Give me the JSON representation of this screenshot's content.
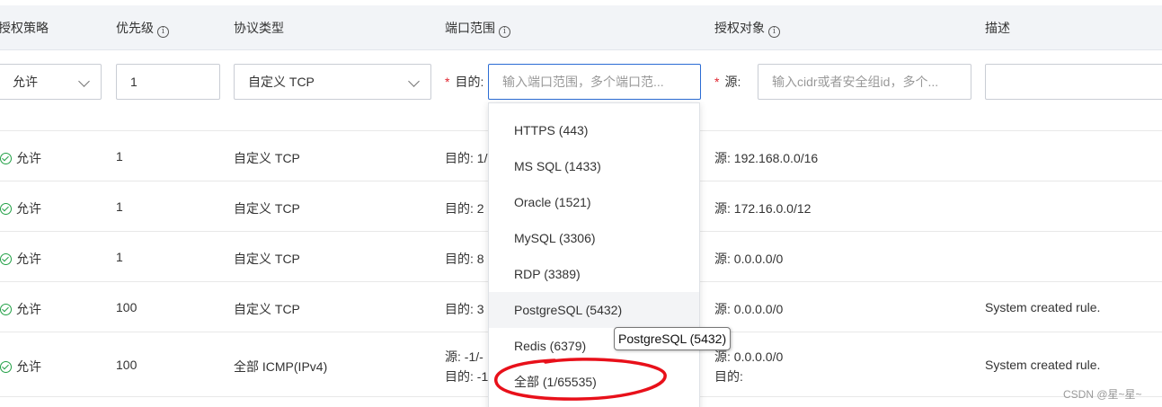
{
  "headers": {
    "policy": "授权策略",
    "priority": "优先级",
    "protocol": "协议类型",
    "port_range": "端口范围",
    "auth_object": "授权对象",
    "description": "描述"
  },
  "edit_row": {
    "policy_value": "允许",
    "priority_value": "1",
    "protocol_value": "自定义 TCP",
    "port_label": "目的:",
    "port_placeholder": "输入端口范围，多个端口范...",
    "source_label": "源:",
    "source_placeholder": "输入cidr或者安全组id，多个..."
  },
  "rows": [
    {
      "policy": "允许",
      "priority": "1",
      "protocol": "自定义 TCP",
      "port": "目的: 1/",
      "port2": "",
      "source": "源: 192.168.0.0/16",
      "source2": "",
      "description": ""
    },
    {
      "policy": "允许",
      "priority": "1",
      "protocol": "自定义 TCP",
      "port": "目的: 2",
      "port2": "",
      "source": "源: 172.16.0.0/12",
      "source2": "",
      "description": ""
    },
    {
      "policy": "允许",
      "priority": "1",
      "protocol": "自定义 TCP",
      "port": "目的: 8",
      "port2": "",
      "source": "源: 0.0.0.0/0",
      "source2": "",
      "description": ""
    },
    {
      "policy": "允许",
      "priority": "100",
      "protocol": "自定义 TCP",
      "port": "目的: 3",
      "port2": "",
      "source": "源: 0.0.0.0/0",
      "source2": "",
      "description": "System created rule."
    },
    {
      "policy": "允许",
      "priority": "100",
      "protocol": "全部 ICMP(IPv4)",
      "port": "源: -1/-",
      "port2": "目的: -1",
      "source": "源: 0.0.0.0/0",
      "source2": "目的:",
      "description": "System created rule."
    }
  ],
  "dropdown": {
    "options": [
      "HTTPS (443)",
      "MS SQL (1433)",
      "Oracle (1521)",
      "MySQL (3306)",
      "RDP (3389)",
      "PostgreSQL (5432)",
      "Redis (6379)",
      "全部 (1/65535)"
    ],
    "hovered_index": 5
  },
  "tooltip": "PostgreSQL (5432)",
  "watermark": "CSDN @星~星~",
  "colors": {
    "header_bg": "#f2f4f7",
    "required": "#e0242f",
    "focus_border": "#2b6cd4",
    "check_green": "#22a046",
    "annotation_red": "#e8101a"
  }
}
